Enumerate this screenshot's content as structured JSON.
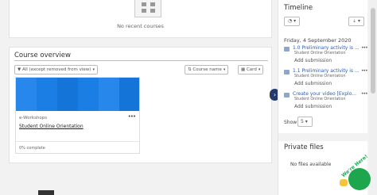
{
  "recent": {
    "empty_text": "No recent courses"
  },
  "course_overview": {
    "title": "Course overview",
    "filter_label": "All (except removed from view)",
    "sort_label": "Course name",
    "view_label": "Card",
    "course": {
      "category": "e-Workshops",
      "name": "Student Online Orientation",
      "progress": "0% complete",
      "menu_icon": "ellipsis-icon",
      "image_color": "#1a7ee4"
    },
    "next_icon": "chevron-right-icon"
  },
  "timeline": {
    "title": "Timeline",
    "filter_icon": "clock-icon",
    "sort_icon": "sort-icon",
    "date": "Friday, 4 September 2020",
    "events": [
      {
        "title": "1.0 Preliminary activity is ...",
        "course": "Student Online Orientation",
        "action": "Add submission"
      },
      {
        "title": "1.1 Preliminary activity is ...",
        "course": "Student Online Orientation",
        "action": "Add submission"
      },
      {
        "title": "Create your video [Explo...",
        "course": "Student Online Orientation",
        "action": "Add submission"
      }
    ],
    "show_label": "Show",
    "show_value": "5"
  },
  "private_files": {
    "title": "Private files",
    "empty_text": "No files available"
  },
  "help": {
    "label": "We're Here!"
  },
  "colors": {
    "accent": "#2a5db0",
    "nav": "#243b6b",
    "help": "#1da64d"
  }
}
